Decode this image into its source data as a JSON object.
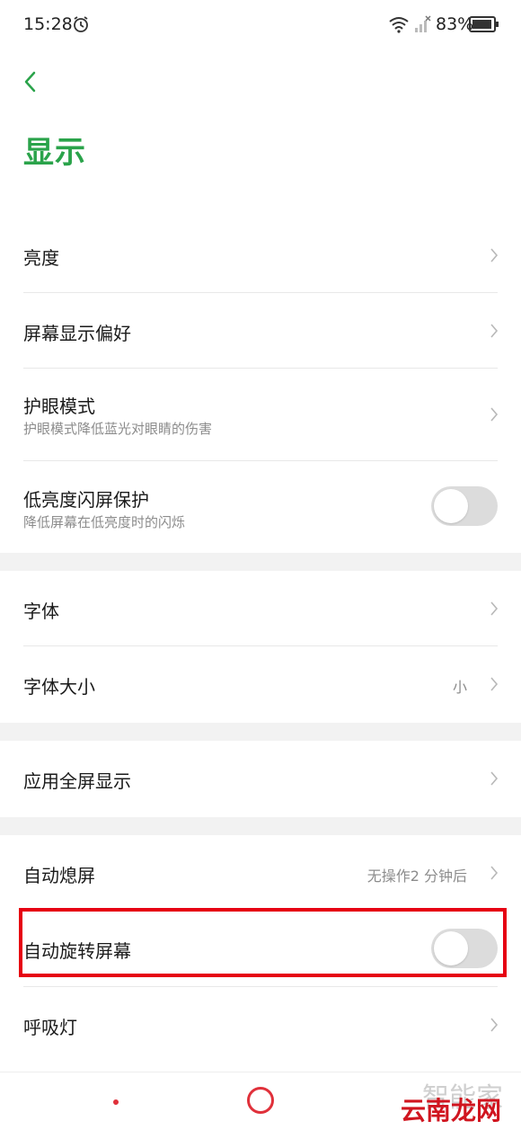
{
  "status_bar": {
    "time": "15:28",
    "battery": "83%"
  },
  "header": {
    "title": "显示"
  },
  "settings": [
    {
      "label": "亮度"
    },
    {
      "label": "屏幕显示偏好"
    },
    {
      "label": "护眼模式",
      "sub": "护眼模式降低蓝光对眼睛的伤害"
    },
    {
      "label": "低亮度闪屏保护",
      "sub": "降低屏幕在低亮度时的闪烁",
      "toggle": false
    },
    {
      "label": "字体"
    },
    {
      "label": "字体大小",
      "value": "小"
    },
    {
      "label": "应用全屏显示"
    },
    {
      "label": "自动熄屏",
      "value": "无操作2 分钟后"
    },
    {
      "label": "自动旋转屏幕",
      "toggle": false
    },
    {
      "label": "呼吸灯"
    }
  ],
  "watermark": {
    "top": "智能家",
    "bottom": "云南龙网"
  },
  "colors": {
    "accent": "#2aa34a",
    "highlight": "#e60012",
    "nav": "#e0303a"
  }
}
